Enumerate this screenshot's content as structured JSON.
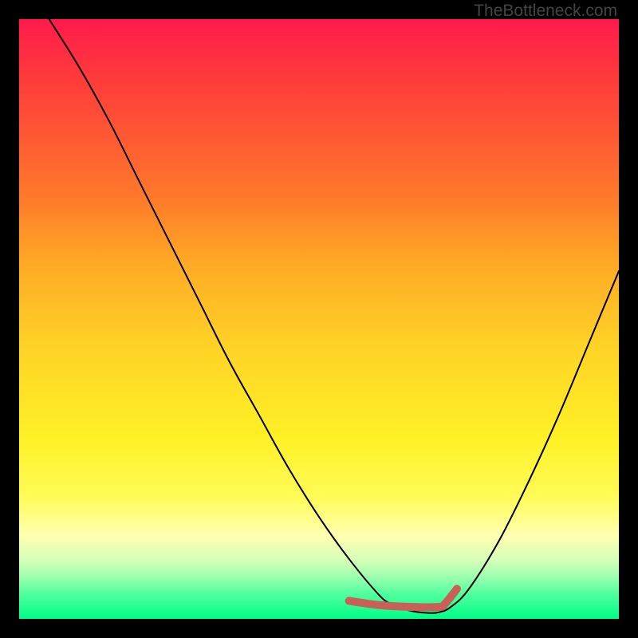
{
  "watermark": "TheBottleneck.com",
  "chart_data": {
    "type": "line",
    "title": "",
    "xlabel": "",
    "ylabel": "",
    "xlim": [
      0,
      100
    ],
    "ylim": [
      0,
      100
    ],
    "series": [
      {
        "name": "bottleneck-curve",
        "type": "line",
        "color": "#000000",
        "x": [
          5,
          10,
          15,
          20,
          25,
          30,
          35,
          40,
          45,
          50,
          55,
          60,
          62,
          64,
          66,
          68,
          70,
          72,
          75,
          80,
          85,
          90,
          95,
          100
        ],
        "y": [
          100,
          92,
          83,
          73,
          63,
          53,
          43,
          34,
          25,
          17,
          10,
          4,
          2.5,
          1.7,
          1.2,
          1.0,
          1.1,
          2.0,
          5,
          13,
          23,
          34,
          46,
          58
        ]
      },
      {
        "name": "optimal-zone",
        "type": "line",
        "color": "#c86058",
        "x": [
          55,
          60,
          65,
          70,
          71,
          73
        ],
        "y": [
          3.0,
          2.3,
          2.0,
          2.0,
          2.5,
          5.0
        ]
      }
    ],
    "gradient_stops": [
      {
        "pct": 0,
        "color": "#ff1a4d"
      },
      {
        "pct": 50,
        "color": "#ffd426"
      },
      {
        "pct": 85,
        "color": "#ffffb0"
      },
      {
        "pct": 100,
        "color": "#00ff88"
      }
    ]
  }
}
